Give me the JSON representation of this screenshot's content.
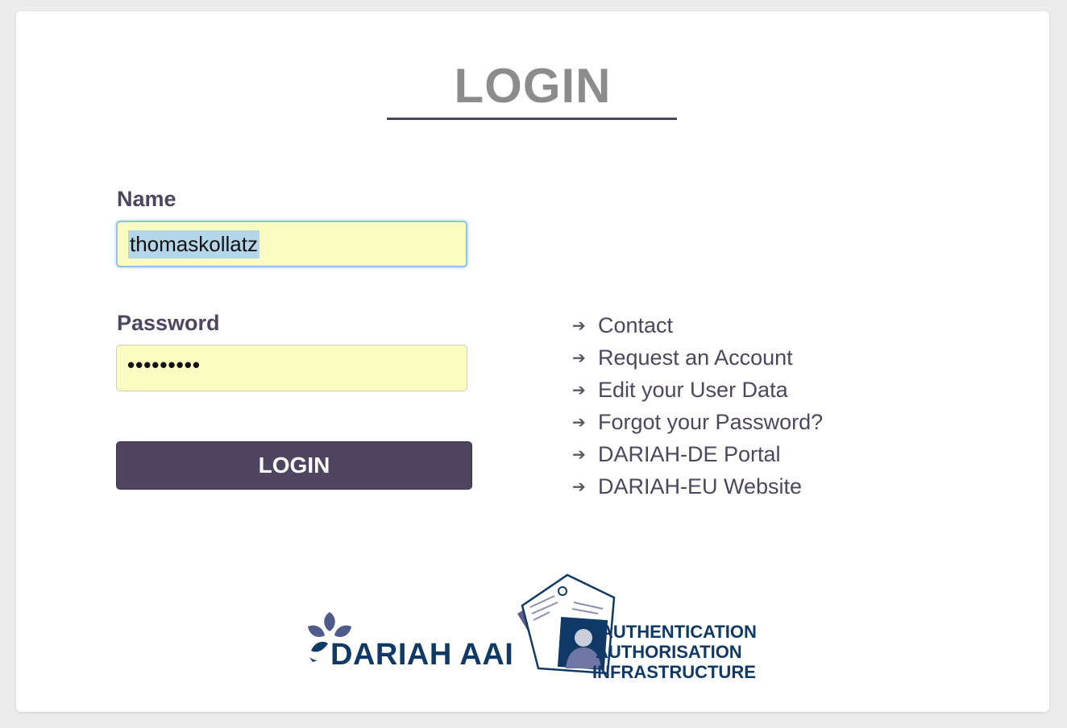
{
  "page": {
    "title": "LOGIN"
  },
  "form": {
    "name_label": "Name",
    "name_value": "thomaskollatz",
    "password_label": "Password",
    "password_value": "•••••••••",
    "login_button": "LOGIN"
  },
  "links": [
    {
      "label": "Contact"
    },
    {
      "label": "Request an Account"
    },
    {
      "label": "Edit your User Data"
    },
    {
      "label": "Forgot your Password?"
    },
    {
      "label": "DARIAH-DE Portal"
    },
    {
      "label": "DARIAH-EU Website"
    }
  ],
  "logo": {
    "wordmark": "DARIAH AAI",
    "line1": "AUTHENTICATION",
    "line2": "AUTHORISATION",
    "line3": "INFRASTRUCTURE"
  },
  "colors": {
    "accent": "#4f4560",
    "title": "#8c8c8c",
    "field_bg": "#fafcc1",
    "logo_blue": "#0f3a67"
  }
}
